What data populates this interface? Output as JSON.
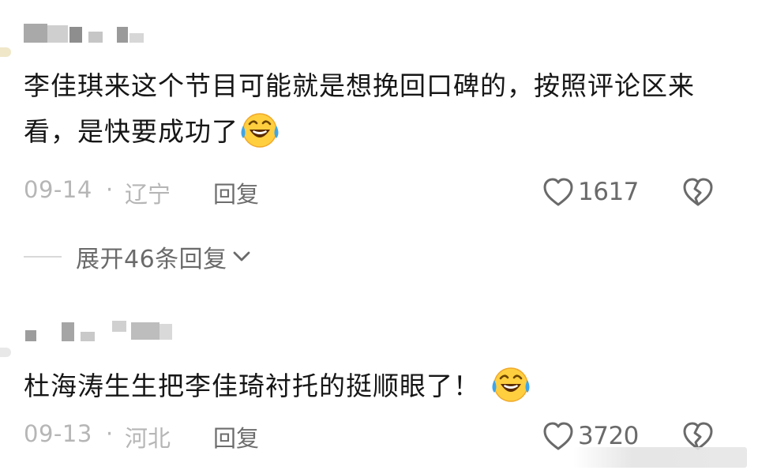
{
  "comments": [
    {
      "text": "李佳琪来这个节目可能就是想挽回口碑的，按照评论区来看，是快要成功了",
      "emoji": "laughing-with-tears-emoji",
      "date": "09-14",
      "separator": "·",
      "location": "辽宁",
      "reply_label": "回复",
      "likes": "1617",
      "expand_label": "展开46条回复"
    },
    {
      "text": "杜海涛生生把李佳琦衬托的挺顺眼了！",
      "emoji": "laughing-with-tears-emoji",
      "date": "09-13",
      "separator": "·",
      "location": "河北",
      "reply_label": "回复",
      "likes": "3720"
    }
  ],
  "icons": {
    "like": "heart-outline-icon",
    "dislike": "broken-heart-icon",
    "expand": "chevron-down-icon"
  },
  "colors": {
    "text": "#161616",
    "meta": "#b6b6b6",
    "action": "#6a6a6a",
    "emoji_face": "#ffcf3f",
    "emoji_tears": "#3fa5ea"
  }
}
